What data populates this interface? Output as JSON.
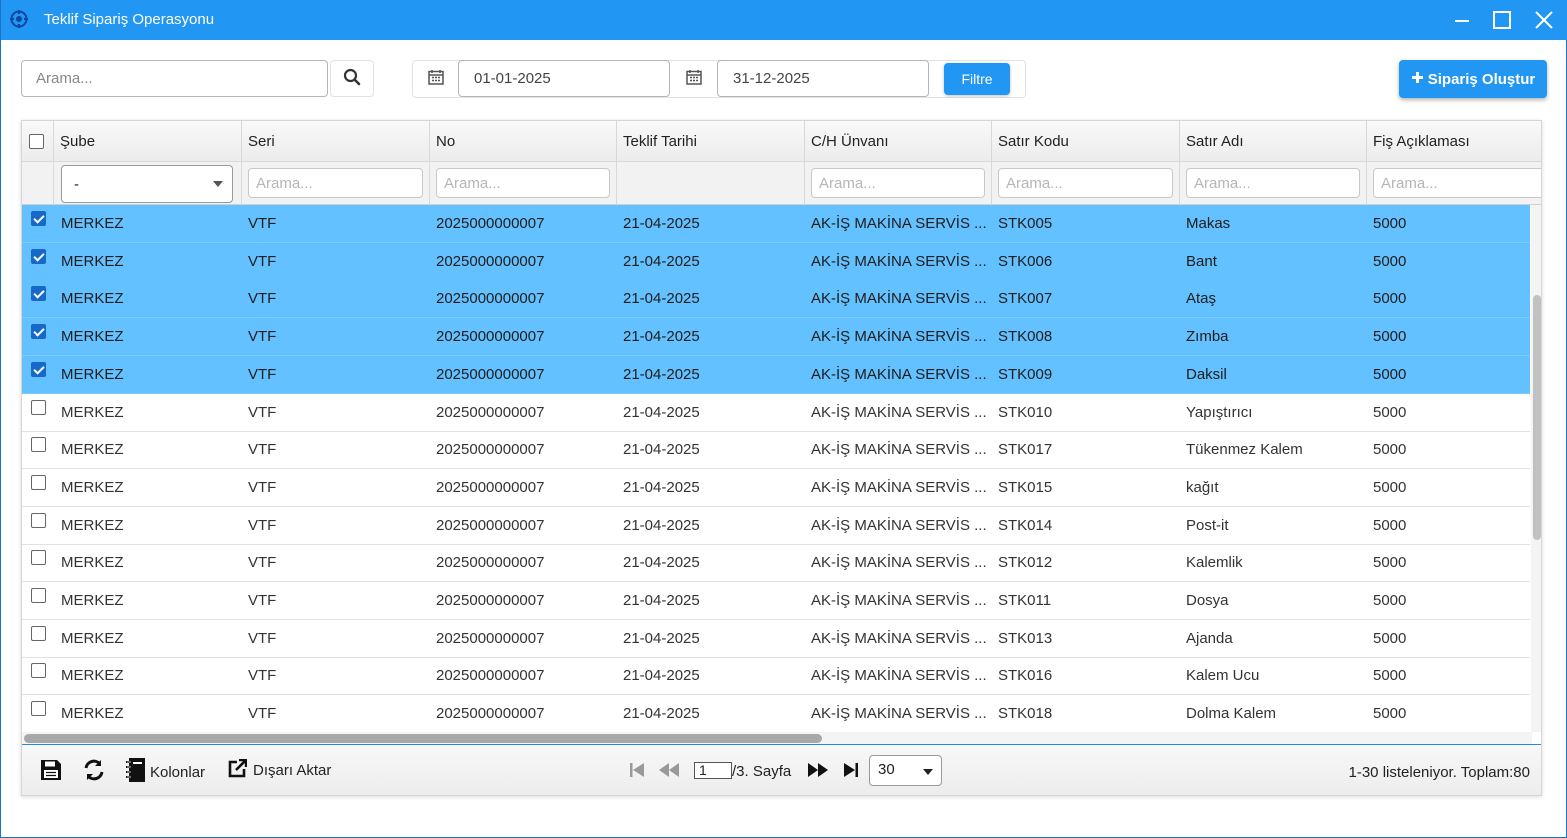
{
  "window": {
    "title": "Teklif Sipariş Operasyonu"
  },
  "toolbar": {
    "search_placeholder": "Arama...",
    "date_from": "01-01-2025",
    "date_to": "31-12-2025",
    "filter_label": "Filtre",
    "create_label": "Sipariş Oluştur"
  },
  "grid": {
    "columns": [
      "Şube",
      "Seri",
      "No",
      "Teklif Tarihi",
      "C/H Ünvanı",
      "Satır Kodu",
      "Satır Adı",
      "Fiş Açıklaması"
    ],
    "filters": {
      "sube_selected": "-",
      "placeholder": "Arama..."
    },
    "rows": [
      {
        "checked": true,
        "sube": "MERKEZ",
        "seri": "VTF",
        "no": "2025000000007",
        "tarih": "21-04-2025",
        "unvan": "AK-İŞ MAKİNA SERVİS ...",
        "kod": "STK005",
        "ad": "Makas",
        "aciklama": "5000"
      },
      {
        "checked": true,
        "sube": "MERKEZ",
        "seri": "VTF",
        "no": "2025000000007",
        "tarih": "21-04-2025",
        "unvan": "AK-İŞ MAKİNA SERVİS ...",
        "kod": "STK006",
        "ad": "Bant",
        "aciklama": "5000"
      },
      {
        "checked": true,
        "sube": "MERKEZ",
        "seri": "VTF",
        "no": "2025000000007",
        "tarih": "21-04-2025",
        "unvan": "AK-İŞ MAKİNA SERVİS ...",
        "kod": "STK007",
        "ad": "Ataş",
        "aciklama": "5000"
      },
      {
        "checked": true,
        "sube": "MERKEZ",
        "seri": "VTF",
        "no": "2025000000007",
        "tarih": "21-04-2025",
        "unvan": "AK-İŞ MAKİNA SERVİS ...",
        "kod": "STK008",
        "ad": "Zımba",
        "aciklama": "5000"
      },
      {
        "checked": true,
        "sube": "MERKEZ",
        "seri": "VTF",
        "no": "2025000000007",
        "tarih": "21-04-2025",
        "unvan": "AK-İŞ MAKİNA SERVİS ...",
        "kod": "STK009",
        "ad": "Daksil",
        "aciklama": "5000"
      },
      {
        "checked": false,
        "sube": "MERKEZ",
        "seri": "VTF",
        "no": "2025000000007",
        "tarih": "21-04-2025",
        "unvan": "AK-İŞ MAKİNA SERVİS ...",
        "kod": "STK010",
        "ad": "Yapıştırıcı",
        "aciklama": "5000"
      },
      {
        "checked": false,
        "sube": "MERKEZ",
        "seri": "VTF",
        "no": "2025000000007",
        "tarih": "21-04-2025",
        "unvan": "AK-İŞ MAKİNA SERVİS ...",
        "kod": "STK017",
        "ad": "Tükenmez Kalem",
        "aciklama": "5000"
      },
      {
        "checked": false,
        "sube": "MERKEZ",
        "seri": "VTF",
        "no": "2025000000007",
        "tarih": "21-04-2025",
        "unvan": "AK-İŞ MAKİNA SERVİS ...",
        "kod": "STK015",
        "ad": "kağıt",
        "aciklama": "5000"
      },
      {
        "checked": false,
        "sube": "MERKEZ",
        "seri": "VTF",
        "no": "2025000000007",
        "tarih": "21-04-2025",
        "unvan": "AK-İŞ MAKİNA SERVİS ...",
        "kod": "STK014",
        "ad": "Post-it",
        "aciklama": "5000"
      },
      {
        "checked": false,
        "sube": "MERKEZ",
        "seri": "VTF",
        "no": "2025000000007",
        "tarih": "21-04-2025",
        "unvan": "AK-İŞ MAKİNA SERVİS ...",
        "kod": "STK012",
        "ad": "Kalemlik",
        "aciklama": "5000"
      },
      {
        "checked": false,
        "sube": "MERKEZ",
        "seri": "VTF",
        "no": "2025000000007",
        "tarih": "21-04-2025",
        "unvan": "AK-İŞ MAKİNA SERVİS ...",
        "kod": "STK011",
        "ad": "Dosya",
        "aciklama": "5000"
      },
      {
        "checked": false,
        "sube": "MERKEZ",
        "seri": "VTF",
        "no": "2025000000007",
        "tarih": "21-04-2025",
        "unvan": "AK-İŞ MAKİNA SERVİS ...",
        "kod": "STK013",
        "ad": "Ajanda",
        "aciklama": "5000"
      },
      {
        "checked": false,
        "sube": "MERKEZ",
        "seri": "VTF",
        "no": "2025000000007",
        "tarih": "21-04-2025",
        "unvan": "AK-İŞ MAKİNA SERVİS ...",
        "kod": "STK016",
        "ad": "Kalem Ucu",
        "aciklama": "5000"
      },
      {
        "checked": false,
        "sube": "MERKEZ",
        "seri": "VTF",
        "no": "2025000000007",
        "tarih": "21-04-2025",
        "unvan": "AK-İŞ MAKİNA SERVİS ...",
        "kod": "STK018",
        "ad": "Dolma Kalem",
        "aciklama": "5000"
      }
    ]
  },
  "pager": {
    "columns_label": "Kolonlar",
    "export_label": "Dışarı Aktar",
    "page_value": "1",
    "page_suffix": "/3. Sayfa",
    "page_size": "30",
    "summary": "1-30 listeleniyor. Toplam:80"
  },
  "colors": {
    "accent": "#2196f3",
    "selected_row": "#64c1ff",
    "checkbox_checked": "#1769c9"
  },
  "icons": [
    "app-logo-icon",
    "minimize-icon",
    "maximize-icon",
    "close-icon",
    "search-icon",
    "calendar-icon",
    "plus-icon",
    "save-icon",
    "refresh-icon",
    "columns-icon",
    "export-icon",
    "first-page-icon",
    "prev-page-icon",
    "next-page-icon",
    "last-page-icon"
  ]
}
